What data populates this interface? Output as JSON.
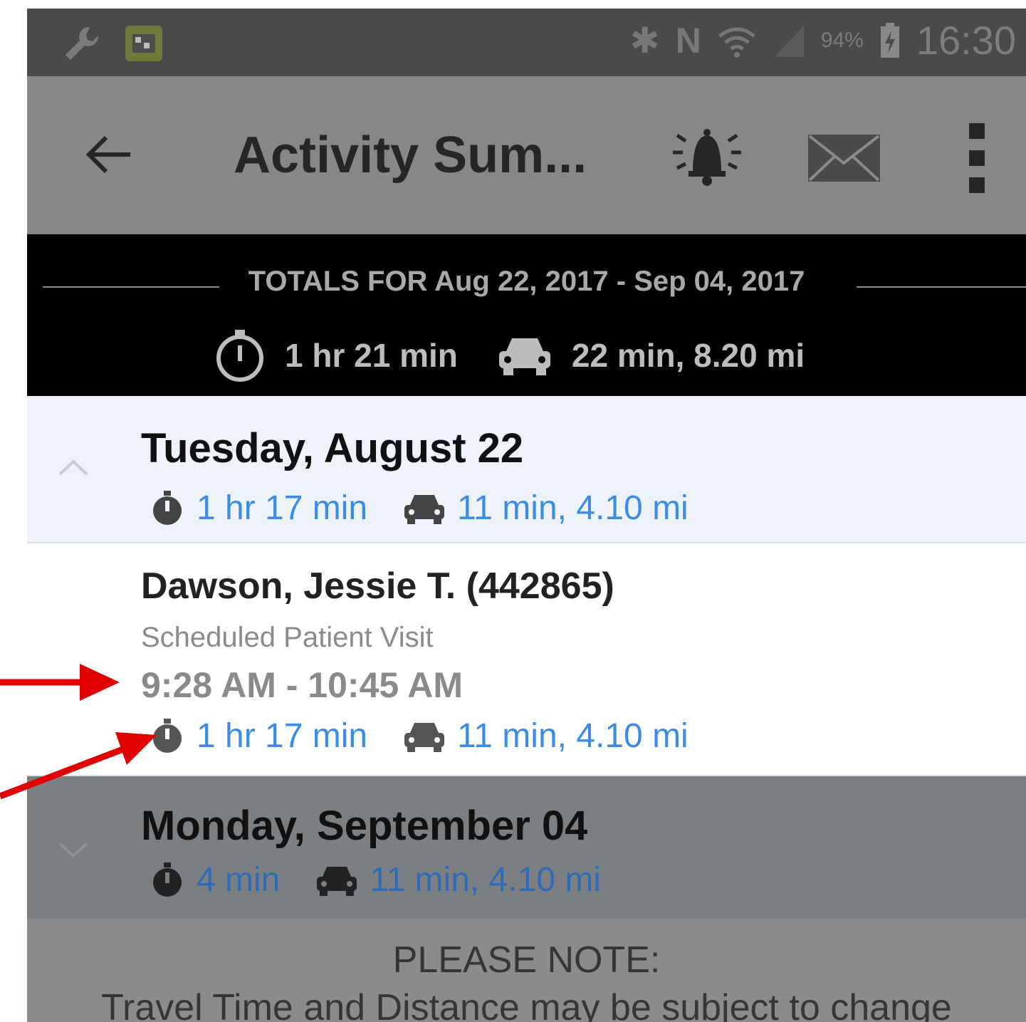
{
  "status_bar": {
    "battery_percent": "94%",
    "time": "16:30",
    "icons": [
      "wrench-icon",
      "app-thumbnail-icon",
      "bluetooth-icon",
      "nfc-icon",
      "wifi-icon",
      "signal-icon",
      "battery-charging-icon"
    ]
  },
  "action_bar": {
    "title": "Activity Sum...",
    "icons": [
      "back-arrow-icon",
      "bell-alert-icon",
      "mail-icon",
      "overflow-menu-icon"
    ]
  },
  "totals": {
    "heading": "TOTALS FOR Aug 22, 2017 - Sep 04, 2017",
    "time": "1 hr 21 min",
    "travel": "22 min, 8.20 mi"
  },
  "days": [
    {
      "title": "Tuesday, August 22",
      "time": "1 hr 17 min",
      "travel": "11 min,  4.10 mi",
      "expanded": true,
      "visits": [
        {
          "patient": "Dawson, Jessie T. (442865)",
          "type": "Scheduled Patient Visit",
          "range": "9:28 AM - 10:45 AM",
          "time": "1 hr 17 min",
          "travel": "11 min,  4.10 mi"
        }
      ]
    },
    {
      "title": "Monday, September 04",
      "time": "4 min",
      "travel": "11 min, 4.10 mi",
      "expanded": false
    }
  ],
  "note": {
    "heading": "PLEASE NOTE:",
    "body": "Travel Time and Distance may be subject to change"
  },
  "colors": {
    "accent_blue": "#3c8ce5",
    "annotation_red": "#e00000"
  }
}
